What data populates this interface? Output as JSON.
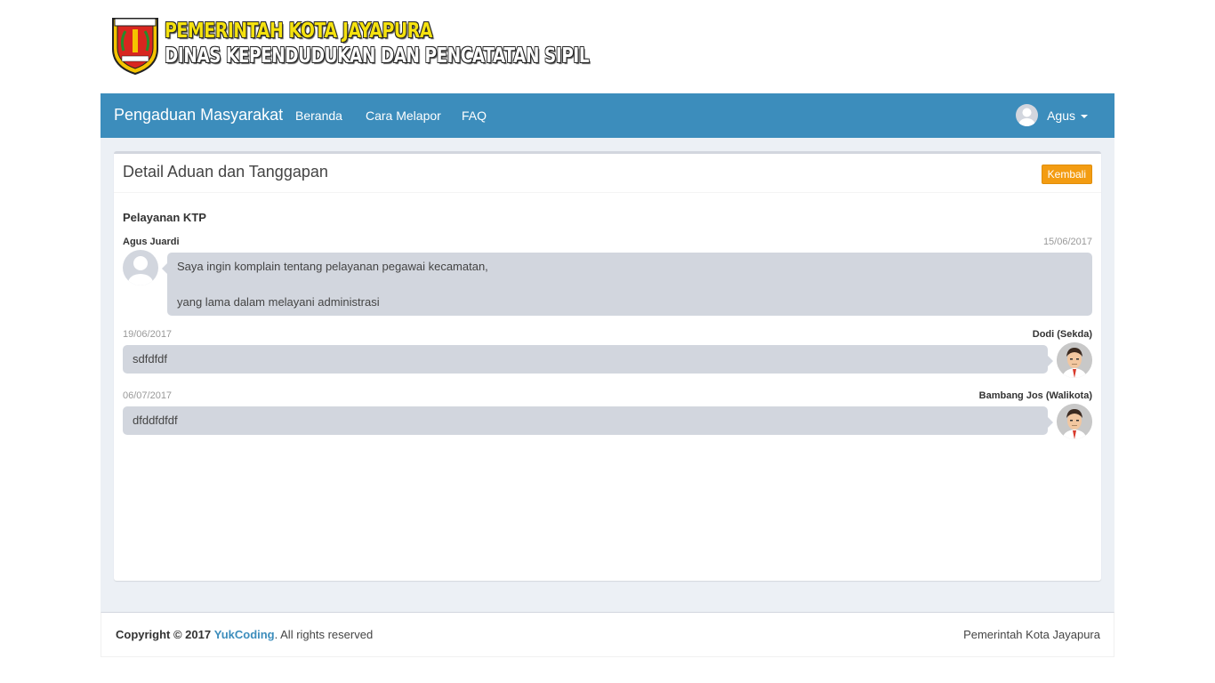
{
  "header": {
    "emblem_text": "KOTA JAYAPURA",
    "title": "PEMERINTAH KOTA JAYAPURA",
    "subtitle": "DINAS KEPENDUDUKAN DAN PENCATATAN SIPIL"
  },
  "navbar": {
    "brand": "Pengaduan Masyarakat",
    "links": [
      "Beranda",
      "Cara Melapor",
      "FAQ"
    ],
    "user_name": "Agus",
    "color": "#3c8dbc"
  },
  "box": {
    "title": "Detail Aduan dan Tanggapan",
    "back_button": "Kembali",
    "subject": "Pelayanan KTP"
  },
  "messages": [
    {
      "name": "Agus Juardi",
      "time": "15/06/2017",
      "lines": [
        "Saya ingin komplain tentang pelayanan pegawai kecamatan,",
        "yang lama dalam melayani administrasi"
      ],
      "avatar": "default-user-icon"
    },
    {
      "name": "Dodi (Sekda)",
      "time": "19/06/2017",
      "text": "sdfdfdf",
      "avatar": "official-avatar-icon"
    },
    {
      "name": "Bambang Jos (Walikota)",
      "time": "06/07/2017",
      "text": "dfddfdfdf",
      "avatar": "official-avatar-icon"
    }
  ],
  "footer": {
    "copyright_prefix": "Copyright © 2017",
    "company": "YukCoding",
    "suffix": ". All rights reserved",
    "right": "Pemerintah Kota Jayapura"
  }
}
